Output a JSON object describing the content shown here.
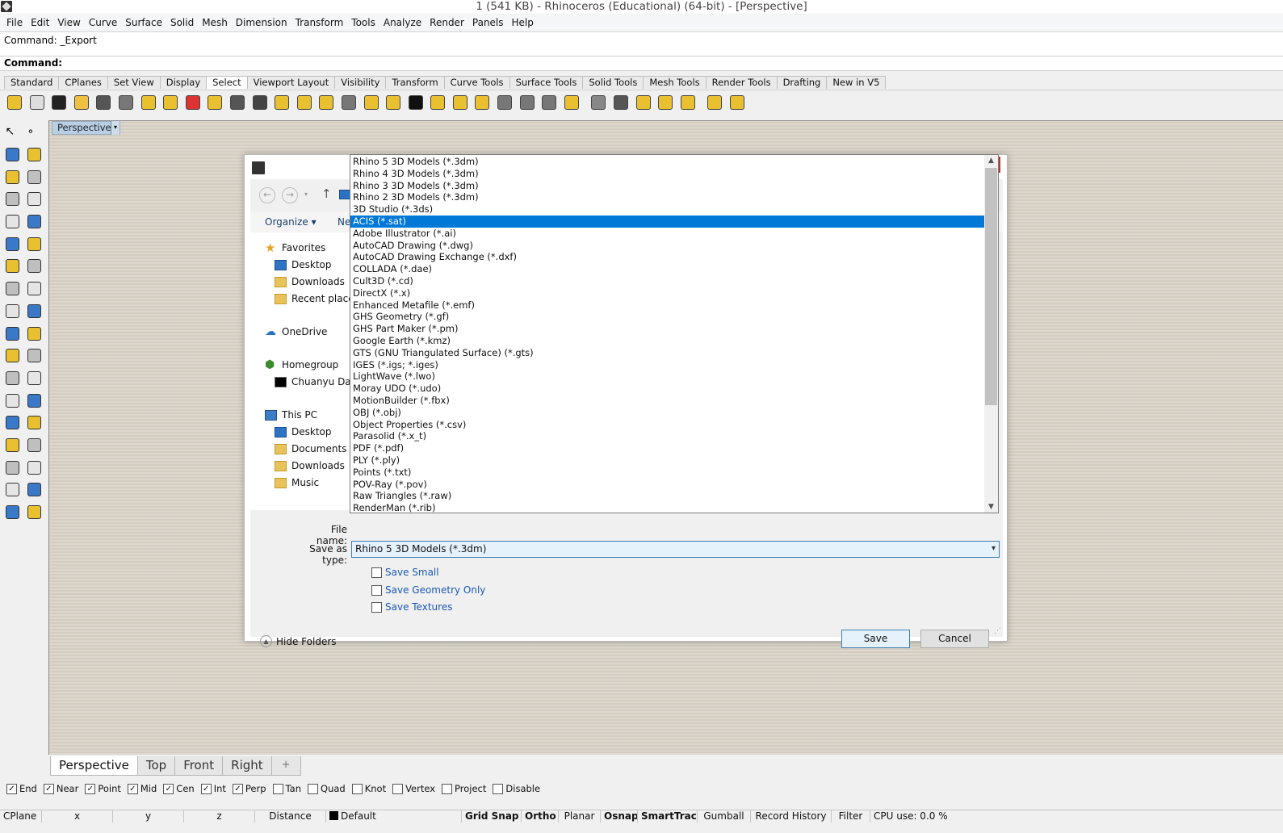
{
  "title": "1 (541 KB) - Rhinoceros (Educational) (64-bit) - [Perspective]",
  "menu": [
    "File",
    "Edit",
    "View",
    "Curve",
    "Surface",
    "Solid",
    "Mesh",
    "Dimension",
    "Transform",
    "Tools",
    "Analyze",
    "Render",
    "Panels",
    "Help"
  ],
  "command": {
    "history": "Command: _Export",
    "prompt": "Command:"
  },
  "toolbar_tabs": [
    "Standard",
    "CPlanes",
    "Set View",
    "Display",
    "Select",
    "Viewport Layout",
    "Visibility",
    "Transform",
    "Curve Tools",
    "Surface Tools",
    "Solid Tools",
    "Mesh Tools",
    "Render Tools",
    "Drafting",
    "New in V5"
  ],
  "active_toolbar_tab": "Select",
  "viewport": {
    "label": "Perspective",
    "menu_glyph": "▾"
  },
  "dialog": {
    "nav": {
      "back": "←",
      "forward": "→",
      "recent": "▾",
      "up": "↑"
    },
    "organize_label": "Organize ▾",
    "new_folder_label": "Ne",
    "nav_pane": [
      {
        "label": "Favorites",
        "icon": "star-icon"
      },
      {
        "label": "Desktop",
        "icon": "desktop-icon"
      },
      {
        "label": "Downloads",
        "icon": "downloads-folder-icon"
      },
      {
        "label": "Recent places",
        "icon": "recent-places-icon"
      },
      {
        "label": "OneDrive",
        "icon": "cloud-icon"
      },
      {
        "label": "Homegroup",
        "icon": "homegroup-icon"
      },
      {
        "label": "Chuanyu Dai",
        "icon": "user-icon"
      },
      {
        "label": "This PC",
        "icon": "computer-icon"
      },
      {
        "label": "Desktop",
        "icon": "desktop-icon"
      },
      {
        "label": "Documents",
        "icon": "documents-folder-icon"
      },
      {
        "label": "Downloads",
        "icon": "downloads-folder-icon"
      },
      {
        "label": "Music",
        "icon": "music-folder-icon"
      }
    ],
    "file_name_label": "File name:",
    "save_as_type_label": "Save as type:",
    "save_as_type_value": "Rhino 5 3D Models (*.3dm)",
    "checkboxes": [
      {
        "label": "Save Small",
        "checked": false
      },
      {
        "label": "Save Geometry Only",
        "checked": false
      },
      {
        "label": "Save Textures",
        "checked": false
      }
    ],
    "hide_folders_label": "Hide Folders",
    "save_label": "Save",
    "cancel_label": "Cancel"
  },
  "dropdown": {
    "options": [
      "Rhino 5 3D Models (*.3dm)",
      "Rhino 4 3D Models (*.3dm)",
      "Rhino 3 3D Models (*.3dm)",
      "Rhino 2 3D Models (*.3dm)",
      "3D Studio (*.3ds)",
      "ACIS (*.sat)",
      "Adobe Illustrator (*.ai)",
      "AutoCAD Drawing (*.dwg)",
      "AutoCAD Drawing Exchange (*.dxf)",
      "COLLADA (*.dae)",
      "Cult3D (*.cd)",
      "DirectX (*.x)",
      "Enhanced Metafile (*.emf)",
      "GHS Geometry (*.gf)",
      "GHS Part Maker (*.pm)",
      "Google Earth (*.kmz)",
      "GTS (GNU Triangulated Surface) (*.gts)",
      "IGES (*.igs; *.iges)",
      "LightWave (*.lwo)",
      "Moray UDO (*.udo)",
      "MotionBuilder (*.fbx)",
      "OBJ (*.obj)",
      "Object Properties (*.csv)",
      "Parasolid (*.x_t)",
      "PDF (*.pdf)",
      "PLY (*.ply)",
      "Points (*.txt)",
      "POV-Ray (*.pov)",
      "Raw Triangles (*.raw)",
      "RenderMan (*.rib)"
    ],
    "selected_index": 5
  },
  "viewport_tabs": [
    "Perspective",
    "Top",
    "Front",
    "Right"
  ],
  "viewport_add_tab": "+",
  "active_viewport_tab": "Perspective",
  "osnaps": [
    {
      "label": "End",
      "checked": true
    },
    {
      "label": "Near",
      "checked": true
    },
    {
      "label": "Point",
      "checked": true
    },
    {
      "label": "Mid",
      "checked": true
    },
    {
      "label": "Cen",
      "checked": true
    },
    {
      "label": "Int",
      "checked": true
    },
    {
      "label": "Perp",
      "checked": true
    },
    {
      "label": "Tan",
      "checked": false
    },
    {
      "label": "Quad",
      "checked": false
    },
    {
      "label": "Knot",
      "checked": false
    },
    {
      "label": "Vertex",
      "checked": false
    },
    {
      "label": "Project",
      "checked": false
    },
    {
      "label": "Disable",
      "checked": false
    }
  ],
  "statusbar": {
    "cplane": "CPlane",
    "x": "x",
    "y": "y",
    "z": "z",
    "distance": "Distance",
    "layer": "Default",
    "toggles": [
      "Grid Snap",
      "Ortho",
      "Planar",
      "Osnap",
      "SmartTrack",
      "Gumball",
      "Record History",
      "Filter"
    ],
    "bold_toggles": [
      "Grid Snap",
      "Ortho",
      "Osnap",
      "SmartTrack"
    ],
    "cpu": "CPU use: 0.0 %"
  },
  "colors": {
    "selection": "#0078d7",
    "viewport_bg": "#d9d3c7",
    "link_blue": "#1b58b5"
  }
}
